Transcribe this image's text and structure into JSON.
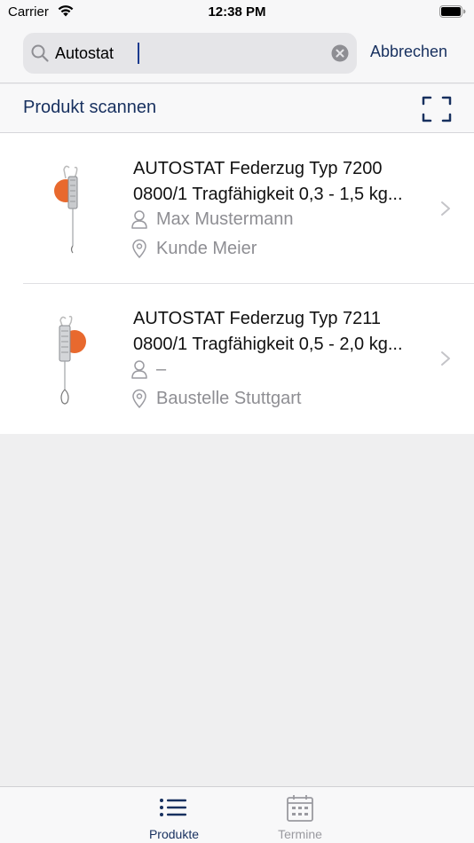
{
  "status_bar": {
    "carrier": "Carrier",
    "time": "12:38 PM"
  },
  "search": {
    "value": "Autostat",
    "cancel_label": "Abbrechen"
  },
  "scan": {
    "label": "Produkt scannen"
  },
  "products": [
    {
      "title_line1": "AUTOSTAT Federzug Typ 7200",
      "title_line2": "0800/1 Tragfähigkeit 0,3 - 1,5 kg...",
      "person": "Max Mustermann",
      "location": "Kunde Meier"
    },
    {
      "title_line1": "AUTOSTAT Federzug Typ 7211",
      "title_line2": "0800/1 Tragfähigkeit 0,5 - 2,0 kg...",
      "person": "–",
      "location": "Baustelle Stuttgart"
    }
  ],
  "tabs": [
    {
      "label": "Produkte",
      "icon": "list-icon",
      "active": true
    },
    {
      "label": "Termine",
      "icon": "calendar-icon",
      "active": false
    }
  ],
  "colors": {
    "accent": "#17305f",
    "secondary_text": "#8e8e93",
    "product_orange": "#e8692e"
  }
}
